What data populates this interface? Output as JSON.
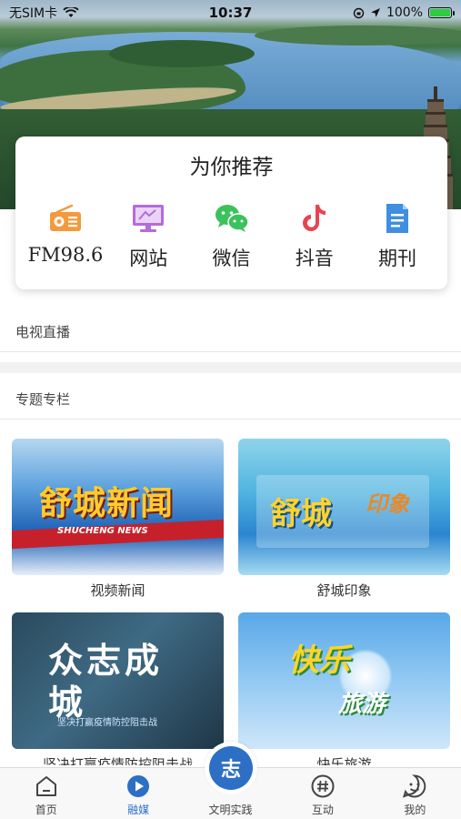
{
  "status_bar": {
    "carrier": "无SIM卡",
    "time": "10:37",
    "battery": "100%"
  },
  "recommend": {
    "title": "为你推荐",
    "items": [
      {
        "label": "FM98.6",
        "icon": "radio-icon",
        "color": "#f39a3d"
      },
      {
        "label": "网站",
        "icon": "monitor-icon",
        "color": "#b36be0"
      },
      {
        "label": "微信",
        "icon": "wechat-icon",
        "color": "#3cc25c"
      },
      {
        "label": "抖音",
        "icon": "tiktok-icon",
        "color": "#e8434f"
      },
      {
        "label": "期刊",
        "icon": "document-icon",
        "color": "#3f8fe0"
      }
    ]
  },
  "sections": {
    "live": "电视直播",
    "columns": "专题专栏"
  },
  "columns": [
    {
      "caption": "视频新闻",
      "thumb_title": "舒城新闻",
      "thumb_sub": "SHUCHENG NEWS"
    },
    {
      "caption": "舒城印象",
      "thumb_title": "舒城",
      "thumb_sub": "印象"
    },
    {
      "caption": "坚决打赢疫情防控阻击战",
      "thumb_title": "众志成城",
      "thumb_sub": "坚决打赢疫情防控阻击战"
    },
    {
      "caption": "快乐旅游",
      "thumb_title": "快乐",
      "thumb_sub": "旅游"
    }
  ],
  "tabbar": {
    "items": [
      {
        "label": "首页",
        "icon": "home-icon"
      },
      {
        "label": "融媒",
        "icon": "play-icon",
        "active": true
      },
      {
        "label": "文明实践",
        "icon": "zhi-icon"
      },
      {
        "label": "互动",
        "icon": "hashtag-icon"
      },
      {
        "label": "我的",
        "icon": "smile-icon"
      }
    ],
    "center_glyph": "志",
    "accent": "#2d6fc5"
  }
}
